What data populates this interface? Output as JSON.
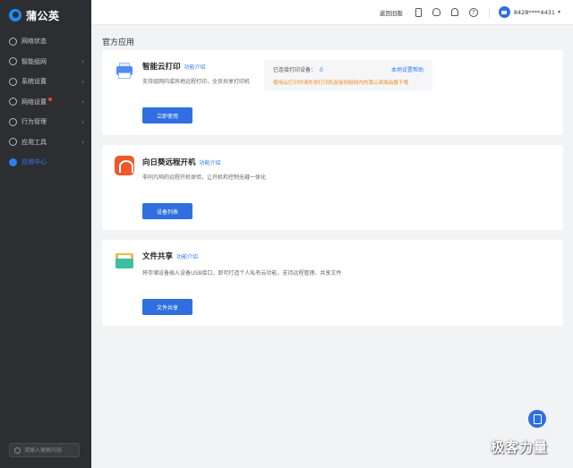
{
  "brand": {
    "name": "蒲公英"
  },
  "sidebar": {
    "items": [
      {
        "label": "网络状态",
        "icon": "globe-icon",
        "has_arrow": false
      },
      {
        "label": "智能组网",
        "icon": "network-icon",
        "has_arrow": true
      },
      {
        "label": "系统设置",
        "icon": "settings-icon",
        "has_arrow": true
      },
      {
        "label": "网络设置",
        "icon": "network-settings-icon",
        "has_arrow": true,
        "badge_dot": true
      },
      {
        "label": "行为管理",
        "icon": "behavior-icon",
        "has_arrow": true
      },
      {
        "label": "应用工具",
        "icon": "tools-icon",
        "has_arrow": true
      },
      {
        "label": "应用中心",
        "icon": "app-center-icon",
        "has_arrow": false,
        "active": true
      }
    ],
    "search_placeholder": "请输入搜索内容"
  },
  "header": {
    "back_link": "返回旧版",
    "device_name": "8428****4431",
    "icons": [
      "phone-icon",
      "robot-icon",
      "bell-icon",
      "help-icon"
    ]
  },
  "main": {
    "section_title": "官方应用",
    "apps": [
      {
        "title": "智能云打印",
        "intro": "功能介绍",
        "desc": "支持组网内或异地远程打印，全员共享打印机",
        "button": "立即使用",
        "icon": "printer-icon",
        "info": {
          "connected_label": "已连接打印设备：",
          "connected_count": "0",
          "help_link": "本地设置帮助",
          "warning": "使用云打印时请先将打印机连接到组网内的蒲公英路由器下哦"
        }
      },
      {
        "title": "向日葵远程开机",
        "intro": "功能介绍",
        "desc": "非同凡响的远程开机体验，让开机和控制无缝一体化",
        "button": "设备列表",
        "icon": "sunflower-icon"
      },
      {
        "title": "文件共享",
        "intro": "功能介绍",
        "desc": "将存储设备插入设备USB接口，即可打造个人私有云功能，支持远程管理、共享文件",
        "button": "文件共享",
        "icon": "folder-icon"
      }
    ]
  },
  "watermark": "极客力量",
  "colors": {
    "accent": "#2f6fe0",
    "sidebar_bg": "#2d2e31",
    "warning": "#f08b1f"
  }
}
